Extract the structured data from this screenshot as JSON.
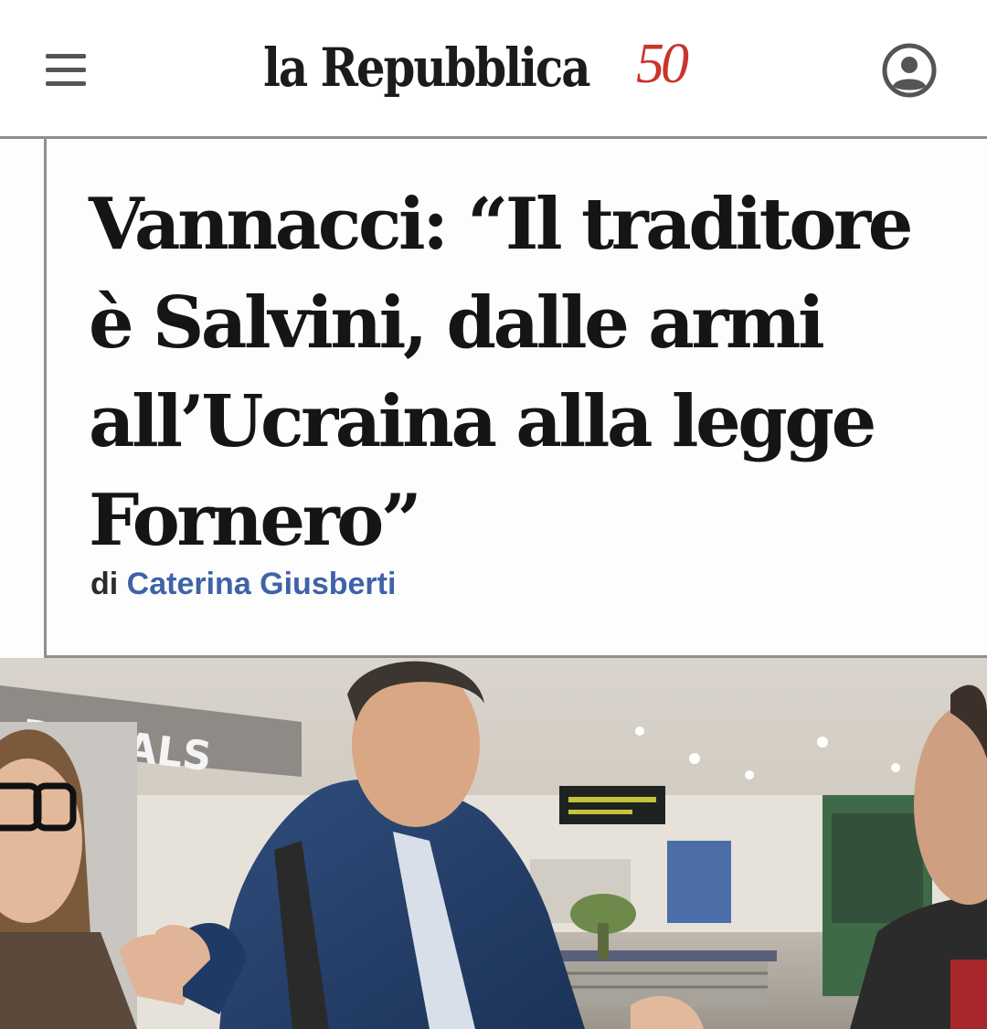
{
  "header": {
    "menu_icon": "hamburger-menu-icon",
    "logo_text": "la Repubblica",
    "logo_badge": "50",
    "user_icon": "user-account-icon"
  },
  "article": {
    "headline": "Vannacci: “Il traditore è Salvini, dalle armi all’Ucraina alla legge Fornero”",
    "byline_prefix": "di",
    "author": "Caterina Giusberti"
  },
  "photo": {
    "sign_text": "RRIVALS"
  },
  "colors": {
    "logo_accent": "#c8352b",
    "author_link": "#3f62a8",
    "divider": "#8f8f8f"
  }
}
